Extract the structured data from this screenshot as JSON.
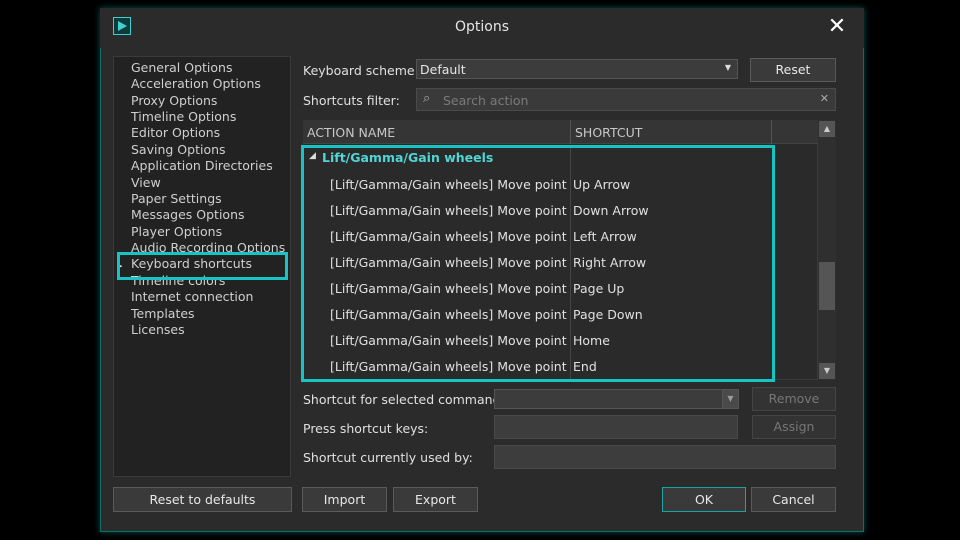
{
  "window": {
    "title": "Options"
  },
  "sidebar": {
    "items": [
      {
        "label": "General Options"
      },
      {
        "label": "Acceleration Options"
      },
      {
        "label": "Proxy Options"
      },
      {
        "label": "Timeline Options"
      },
      {
        "label": "Editor Options"
      },
      {
        "label": "Saving Options"
      },
      {
        "label": "Application Directories"
      },
      {
        "label": "View"
      },
      {
        "label": "Paper Settings"
      },
      {
        "label": "Messages Options"
      },
      {
        "label": "Player Options"
      },
      {
        "label": "Audio Recording Options"
      },
      {
        "label": "Keyboard shortcuts"
      },
      {
        "label": "Timeline colors"
      },
      {
        "label": "Internet connection"
      },
      {
        "label": "Templates"
      },
      {
        "label": "Licenses"
      }
    ],
    "selected": "Keyboard shortcuts"
  },
  "scheme": {
    "label": "Keyboard scheme:",
    "value": "Default",
    "reset": "Reset"
  },
  "filter": {
    "label": "Shortcuts filter:",
    "placeholder": "Search action"
  },
  "table": {
    "headers": {
      "action": "ACTION NAME",
      "shortcut": "SHORTCUT"
    },
    "group": "Lift/Gamma/Gain wheels",
    "rows": [
      {
        "action": "[Lift/Gamma/Gain wheels] Move point ...",
        "shortcut": "Up Arrow"
      },
      {
        "action": "[Lift/Gamma/Gain wheels] Move point ...",
        "shortcut": "Down Arrow"
      },
      {
        "action": "[Lift/Gamma/Gain wheels] Move point ...",
        "shortcut": "Left Arrow"
      },
      {
        "action": "[Lift/Gamma/Gain wheels] Move point ...",
        "shortcut": "Right Arrow"
      },
      {
        "action": "[Lift/Gamma/Gain wheels] Move point ...",
        "shortcut": "Page Up"
      },
      {
        "action": "[Lift/Gamma/Gain wheels] Move point ...",
        "shortcut": "Page Down"
      },
      {
        "action": "[Lift/Gamma/Gain wheels] Move point ...",
        "shortcut": "Home"
      },
      {
        "action": "[Lift/Gamma/Gain wheels] Move point ...",
        "shortcut": "End"
      }
    ]
  },
  "selected_shortcut": {
    "label": "Shortcut for selected commands:",
    "remove": "Remove"
  },
  "press_keys": {
    "label": "Press shortcut keys:",
    "assign": "Assign"
  },
  "used_by": {
    "label": "Shortcut currently used by:"
  },
  "footer": {
    "reset_defaults": "Reset to defaults",
    "import": "Import",
    "export": "Export",
    "ok": "OK",
    "cancel": "Cancel"
  },
  "colors": {
    "accent": "#17c3c3",
    "group_text": "#4fd6d6",
    "background": "#2b2b2b"
  }
}
